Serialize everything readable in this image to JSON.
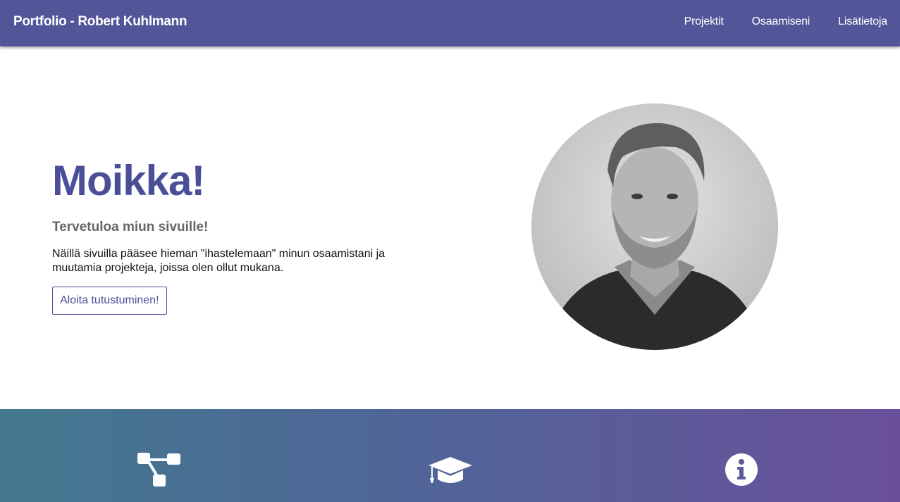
{
  "navbar": {
    "brand": "Portfolio - Robert Kuhlmann",
    "links": [
      "Projektit",
      "Osaamiseni",
      "Lisätietoja"
    ]
  },
  "hero": {
    "title": "Moikka!",
    "subtitle": "Tervetuloa miun sivuille!",
    "description": "Näillä sivuilla pääsee hieman \"ihastelemaan\" minun osaamistani ja muutamia projekteja, joissa olen ollut mukana.",
    "button_label": "Aloita tutustuminen!"
  },
  "portrait": {
    "icon": "portrait-photo"
  },
  "features": {
    "icons": [
      "sitemap-icon",
      "graduation-cap-icon",
      "info-circle-icon"
    ]
  },
  "colors": {
    "navbar": "#535599",
    "accent": "#4b4f97",
    "gradient_start": "#43798f",
    "gradient_end": "#6a509b"
  }
}
